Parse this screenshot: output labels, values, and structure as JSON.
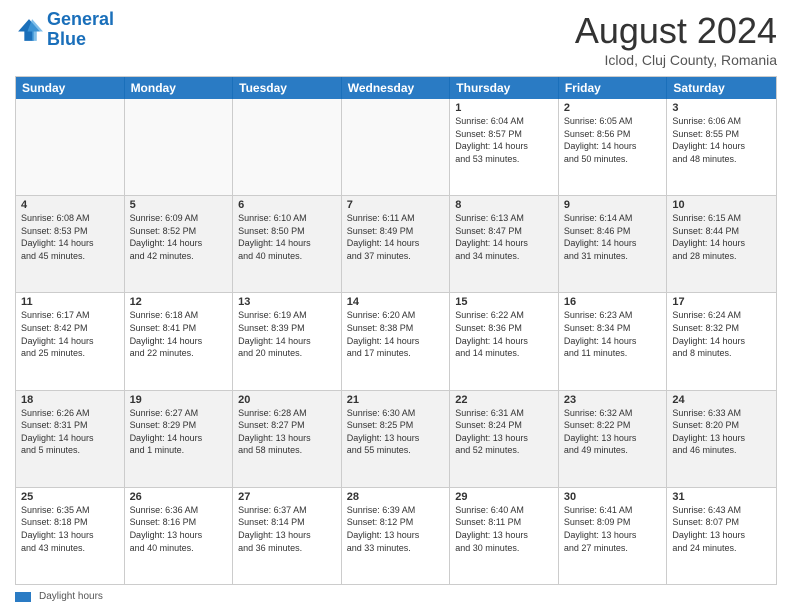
{
  "header": {
    "logo_line1": "General",
    "logo_line2": "Blue",
    "month": "August 2024",
    "location": "Iclod, Cluj County, Romania"
  },
  "days_of_week": [
    "Sunday",
    "Monday",
    "Tuesday",
    "Wednesday",
    "Thursday",
    "Friday",
    "Saturday"
  ],
  "footer": {
    "swatch_label": "Daylight hours"
  },
  "weeks": [
    [
      {
        "day": "",
        "info": ""
      },
      {
        "day": "",
        "info": ""
      },
      {
        "day": "",
        "info": ""
      },
      {
        "day": "",
        "info": ""
      },
      {
        "day": "1",
        "info": "Sunrise: 6:04 AM\nSunset: 8:57 PM\nDaylight: 14 hours\nand 53 minutes."
      },
      {
        "day": "2",
        "info": "Sunrise: 6:05 AM\nSunset: 8:56 PM\nDaylight: 14 hours\nand 50 minutes."
      },
      {
        "day": "3",
        "info": "Sunrise: 6:06 AM\nSunset: 8:55 PM\nDaylight: 14 hours\nand 48 minutes."
      }
    ],
    [
      {
        "day": "4",
        "info": "Sunrise: 6:08 AM\nSunset: 8:53 PM\nDaylight: 14 hours\nand 45 minutes."
      },
      {
        "day": "5",
        "info": "Sunrise: 6:09 AM\nSunset: 8:52 PM\nDaylight: 14 hours\nand 42 minutes."
      },
      {
        "day": "6",
        "info": "Sunrise: 6:10 AM\nSunset: 8:50 PM\nDaylight: 14 hours\nand 40 minutes."
      },
      {
        "day": "7",
        "info": "Sunrise: 6:11 AM\nSunset: 8:49 PM\nDaylight: 14 hours\nand 37 minutes."
      },
      {
        "day": "8",
        "info": "Sunrise: 6:13 AM\nSunset: 8:47 PM\nDaylight: 14 hours\nand 34 minutes."
      },
      {
        "day": "9",
        "info": "Sunrise: 6:14 AM\nSunset: 8:46 PM\nDaylight: 14 hours\nand 31 minutes."
      },
      {
        "day": "10",
        "info": "Sunrise: 6:15 AM\nSunset: 8:44 PM\nDaylight: 14 hours\nand 28 minutes."
      }
    ],
    [
      {
        "day": "11",
        "info": "Sunrise: 6:17 AM\nSunset: 8:42 PM\nDaylight: 14 hours\nand 25 minutes."
      },
      {
        "day": "12",
        "info": "Sunrise: 6:18 AM\nSunset: 8:41 PM\nDaylight: 14 hours\nand 22 minutes."
      },
      {
        "day": "13",
        "info": "Sunrise: 6:19 AM\nSunset: 8:39 PM\nDaylight: 14 hours\nand 20 minutes."
      },
      {
        "day": "14",
        "info": "Sunrise: 6:20 AM\nSunset: 8:38 PM\nDaylight: 14 hours\nand 17 minutes."
      },
      {
        "day": "15",
        "info": "Sunrise: 6:22 AM\nSunset: 8:36 PM\nDaylight: 14 hours\nand 14 minutes."
      },
      {
        "day": "16",
        "info": "Sunrise: 6:23 AM\nSunset: 8:34 PM\nDaylight: 14 hours\nand 11 minutes."
      },
      {
        "day": "17",
        "info": "Sunrise: 6:24 AM\nSunset: 8:32 PM\nDaylight: 14 hours\nand 8 minutes."
      }
    ],
    [
      {
        "day": "18",
        "info": "Sunrise: 6:26 AM\nSunset: 8:31 PM\nDaylight: 14 hours\nand 5 minutes."
      },
      {
        "day": "19",
        "info": "Sunrise: 6:27 AM\nSunset: 8:29 PM\nDaylight: 14 hours\nand 1 minute."
      },
      {
        "day": "20",
        "info": "Sunrise: 6:28 AM\nSunset: 8:27 PM\nDaylight: 13 hours\nand 58 minutes."
      },
      {
        "day": "21",
        "info": "Sunrise: 6:30 AM\nSunset: 8:25 PM\nDaylight: 13 hours\nand 55 minutes."
      },
      {
        "day": "22",
        "info": "Sunrise: 6:31 AM\nSunset: 8:24 PM\nDaylight: 13 hours\nand 52 minutes."
      },
      {
        "day": "23",
        "info": "Sunrise: 6:32 AM\nSunset: 8:22 PM\nDaylight: 13 hours\nand 49 minutes."
      },
      {
        "day": "24",
        "info": "Sunrise: 6:33 AM\nSunset: 8:20 PM\nDaylight: 13 hours\nand 46 minutes."
      }
    ],
    [
      {
        "day": "25",
        "info": "Sunrise: 6:35 AM\nSunset: 8:18 PM\nDaylight: 13 hours\nand 43 minutes."
      },
      {
        "day": "26",
        "info": "Sunrise: 6:36 AM\nSunset: 8:16 PM\nDaylight: 13 hours\nand 40 minutes."
      },
      {
        "day": "27",
        "info": "Sunrise: 6:37 AM\nSunset: 8:14 PM\nDaylight: 13 hours\nand 36 minutes."
      },
      {
        "day": "28",
        "info": "Sunrise: 6:39 AM\nSunset: 8:12 PM\nDaylight: 13 hours\nand 33 minutes."
      },
      {
        "day": "29",
        "info": "Sunrise: 6:40 AM\nSunset: 8:11 PM\nDaylight: 13 hours\nand 30 minutes."
      },
      {
        "day": "30",
        "info": "Sunrise: 6:41 AM\nSunset: 8:09 PM\nDaylight: 13 hours\nand 27 minutes."
      },
      {
        "day": "31",
        "info": "Sunrise: 6:43 AM\nSunset: 8:07 PM\nDaylight: 13 hours\nand 24 minutes."
      }
    ]
  ]
}
